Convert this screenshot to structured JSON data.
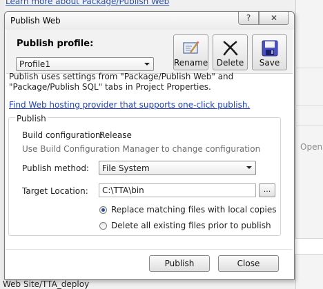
{
  "background": {
    "top_link": "Learn more about Package/Publish Web",
    "right_open_label": "Open",
    "bottom_text": "Web Site/TTA_deploy"
  },
  "dialog": {
    "title": "Publish Web",
    "help_button": "?",
    "close_button": "✕",
    "profile": {
      "label": "Publish profile:",
      "selected": "Profile1"
    },
    "toolbar": {
      "rename": "Rename",
      "delete": "Delete",
      "save": "Save"
    },
    "description": "Publish uses settings from \"Package/Publish Web\" and \"Package/Publish SQL\" tabs in Project Properties.",
    "hosting_link": "Find Web hosting provider that supports one-click publish.",
    "publish_group": {
      "title": "Publish",
      "build_config_label": "Build configuration:",
      "build_config_value": "Release",
      "build_config_hint": "Use Build Configuration Manager to change configuration",
      "method_label": "Publish method:",
      "method_value": "File System",
      "target_label": "Target Location:",
      "target_value": "C:\\TTA\\bin",
      "browse_label": "...",
      "option_replace": "Replace matching files with local copies",
      "option_delete": "Delete all existing files prior to publish",
      "selected_option": "replace"
    },
    "buttons": {
      "publish": "Publish",
      "close": "Close"
    }
  },
  "colors": {
    "link": "#1e3fc8",
    "radio_selected": "#1f4f9a",
    "dialog_bg": "#ffffff",
    "chrome_bg": "#f0f0f0"
  }
}
